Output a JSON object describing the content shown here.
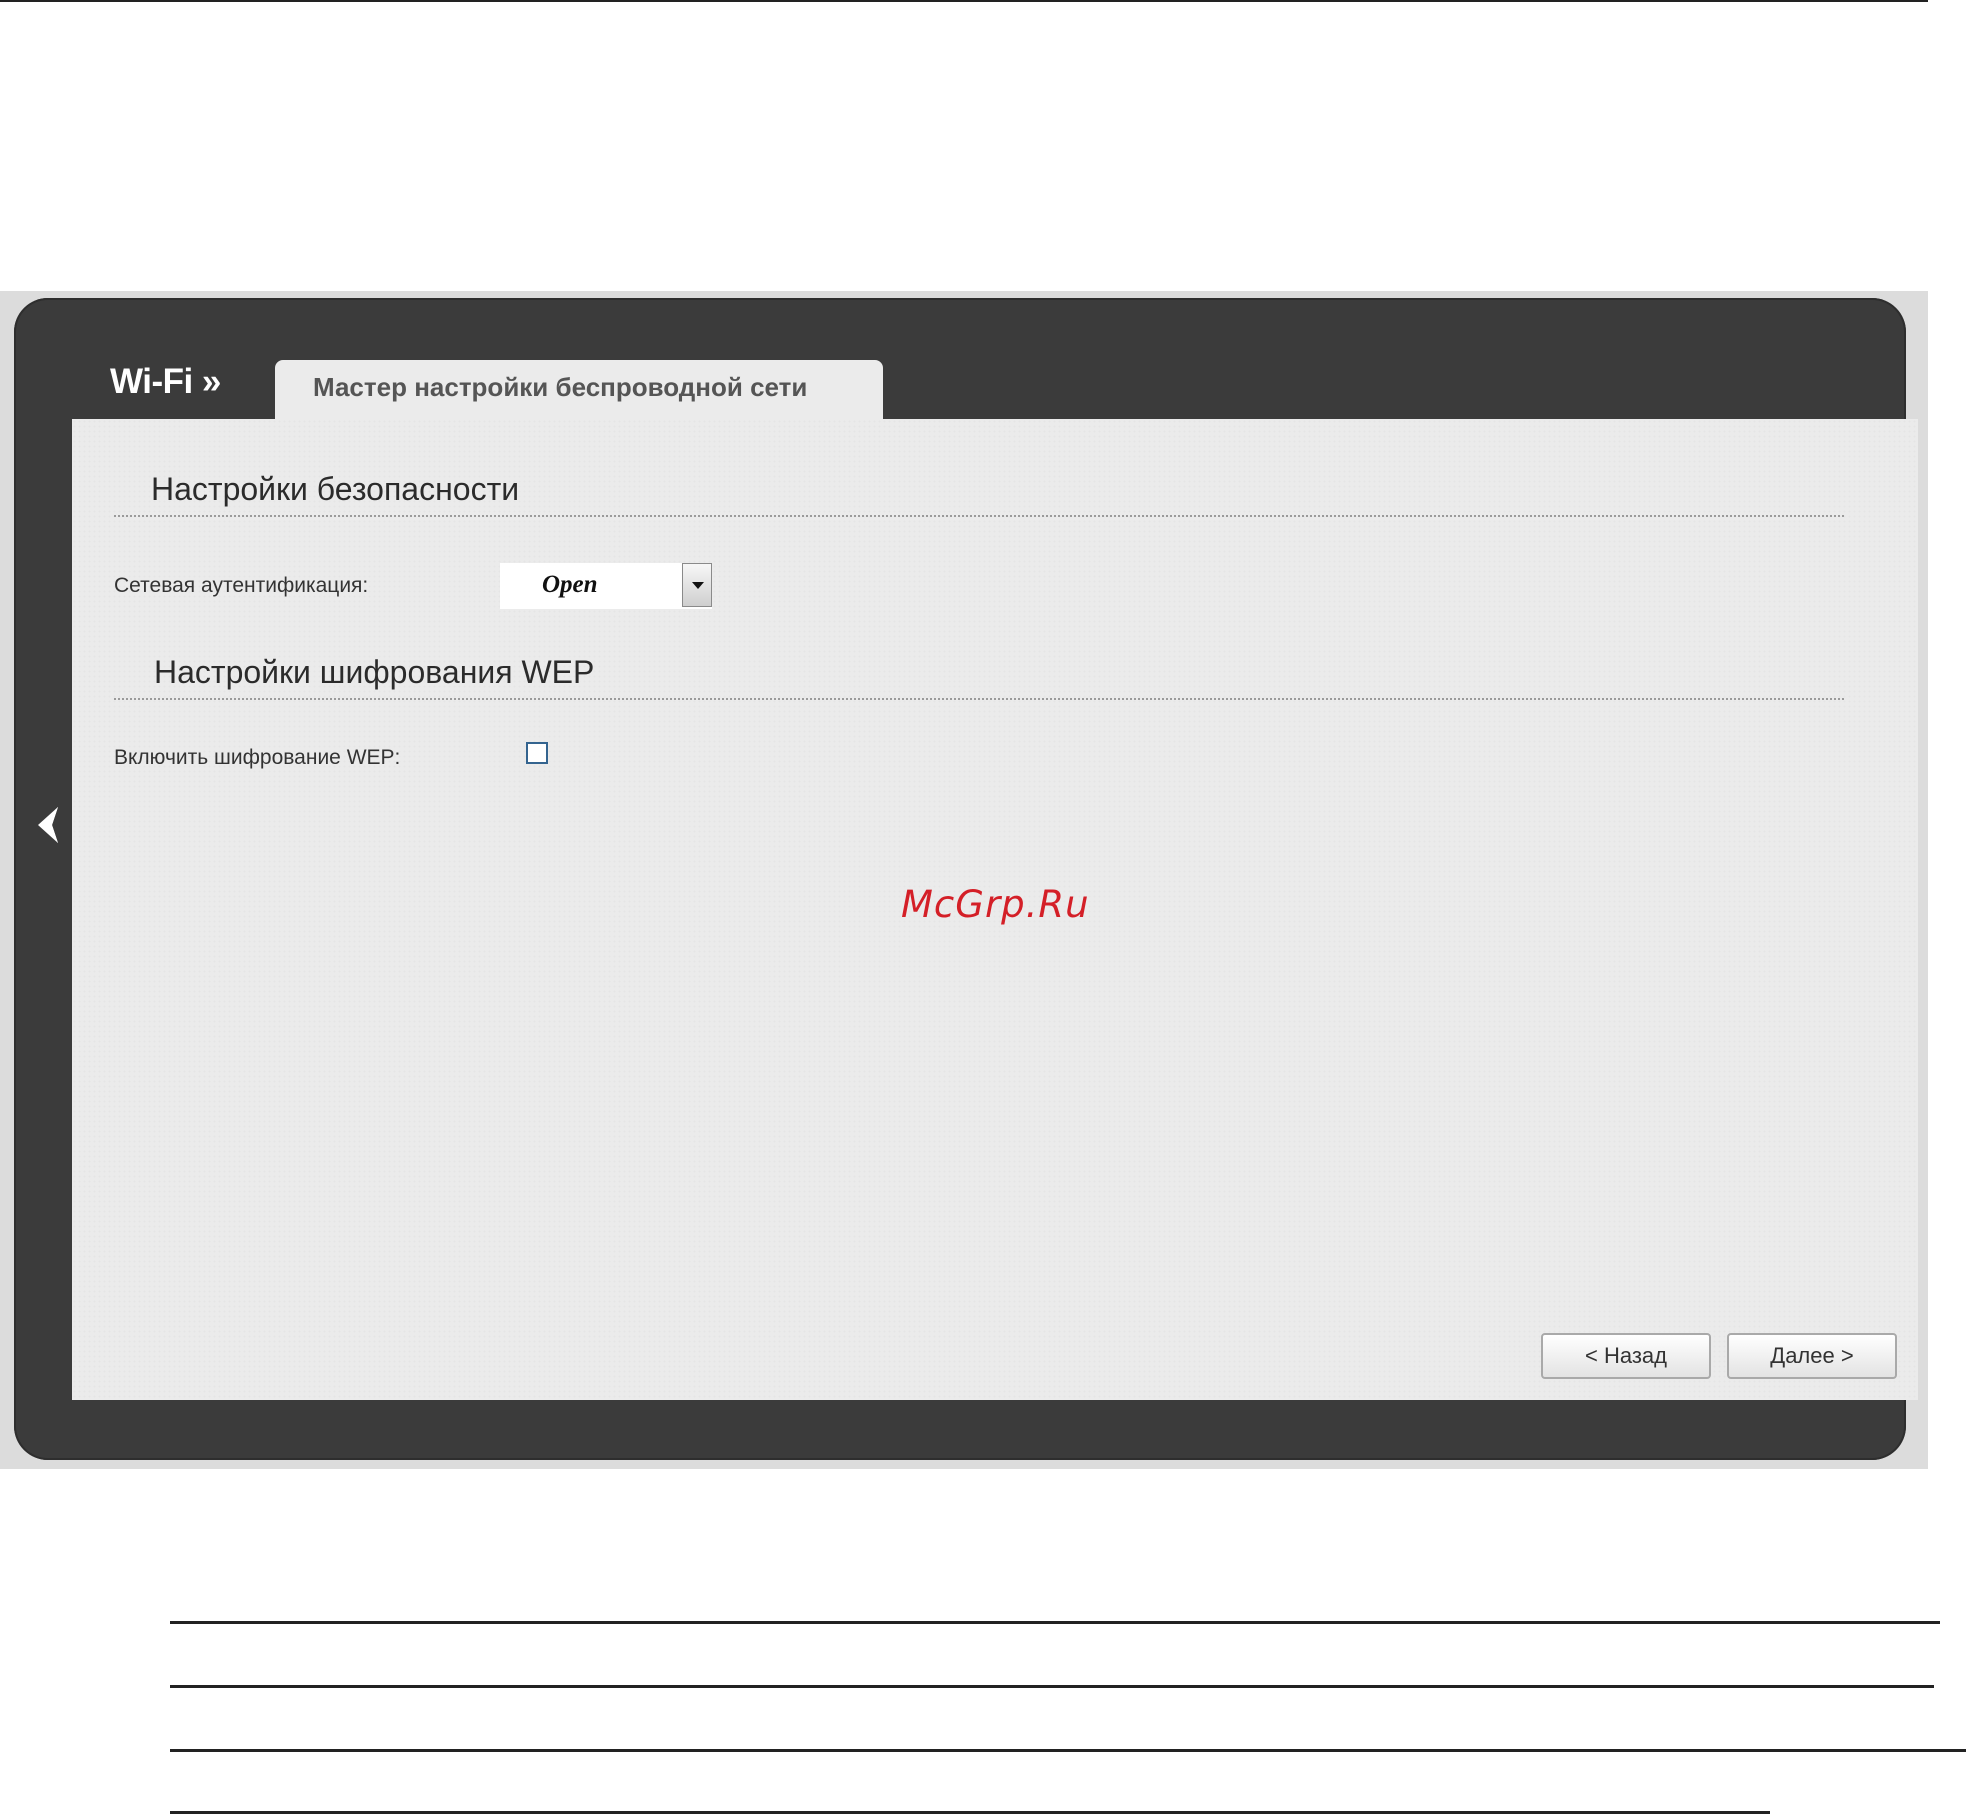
{
  "header": {
    "breadcrumb": "Wi-Fi »",
    "tab_label": "Мастер настройки беспроводной сети"
  },
  "security_section": {
    "title": "Настройки безопасности",
    "auth_label": "Сетевая аутентификация:",
    "auth_value": "Open"
  },
  "wep_section": {
    "title": "Настройки шифрования WEP",
    "enable_label": "Включить шифрование WEP:",
    "enable_checked": false
  },
  "watermark": "McGrp.Ru",
  "buttons": {
    "back_label": "< Назад",
    "next_label": "Далее >"
  },
  "icons": {
    "sidebar_toggle": "chevron-left-icon",
    "dropdown": "chevron-down-icon"
  },
  "colors": {
    "frame": "#3b3b3b",
    "panel": "#ebebeb",
    "watermark": "#d41f27",
    "checkbox_border": "#34648f"
  }
}
